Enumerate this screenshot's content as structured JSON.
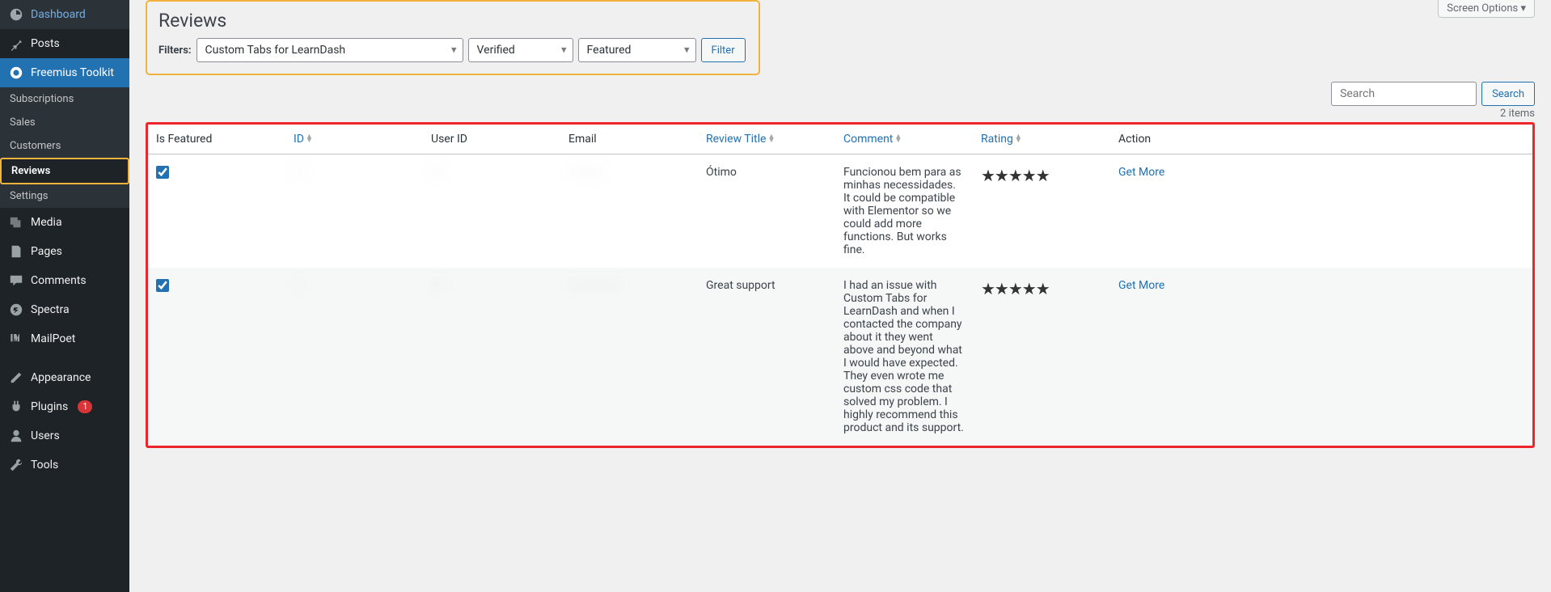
{
  "screen_options_label": "Screen Options",
  "sidebar": {
    "items": {
      "dashboard": "Dashboard",
      "posts": "Posts",
      "freemius": "Freemius Toolkit",
      "media": "Media",
      "pages": "Pages",
      "comments": "Comments",
      "spectra": "Spectra",
      "mailpoet": "MailPoet",
      "appearance": "Appearance",
      "plugins": "Plugins",
      "plugins_update_count": "1",
      "users": "Users",
      "tools": "Tools"
    },
    "freemius_sub": {
      "subscriptions": "Subscriptions",
      "sales": "Sales",
      "customers": "Customers",
      "reviews": "Reviews",
      "settings": "Settings"
    }
  },
  "page": {
    "title": "Reviews",
    "filters_label": "Filters:",
    "filter_plugin": "Custom Tabs for LearnDash",
    "filter_status": "Verified",
    "filter_featured": "Featured",
    "filter_button": "Filter",
    "search_placeholder": "Search",
    "search_button": "Search",
    "items_count": "2 items"
  },
  "table": {
    "headers": {
      "is_featured": "Is Featured",
      "id": "ID",
      "user_id": "User ID",
      "email": "Email",
      "review_title": "Review Title",
      "comment": "Comment",
      "rating": "Rating",
      "action": "Action"
    },
    "rows": [
      {
        "featured": true,
        "id": "····",
        "user_id": "·····",
        "email": "············",
        "title": "Ótimo",
        "comment": "Funcionou bem para as minhas necessidades. It could be compatible with Elementor so we could add more functions. But works fine.",
        "rating": 5,
        "action": "Get More"
      },
      {
        "featured": true,
        "id": "····",
        "user_id": "·····",
        "email": "··················",
        "title": "Great support",
        "comment": "I had an issue with Custom Tabs for LearnDash and when I contacted the company about it they went above and beyond what I would have expected. They even wrote me custom css code that solved my problem. I highly recommend this product and its support.",
        "rating": 5,
        "action": "Get More"
      }
    ]
  }
}
